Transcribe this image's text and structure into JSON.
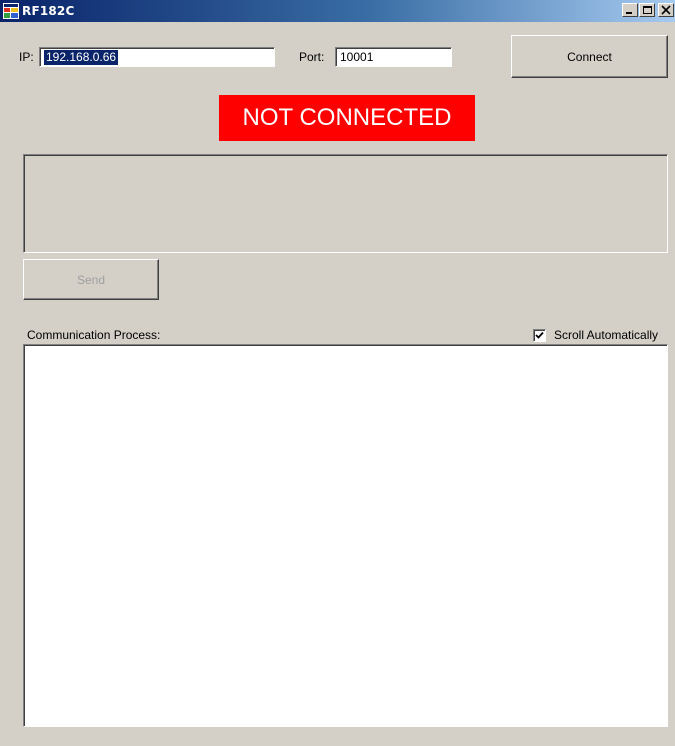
{
  "window": {
    "title": "RF182C",
    "icon": "app-window-icon",
    "controls": {
      "minimize": "minimize-icon",
      "maximize": "maximize-icon",
      "close": "close-icon"
    }
  },
  "connection": {
    "ip_label": "IP:",
    "ip_value": "192.168.0.66",
    "port_label": "Port:",
    "port_value": "10001",
    "connect_button": "Connect"
  },
  "status": {
    "text": "NOT CONNECTED",
    "color": "#ff0000"
  },
  "send": {
    "message_value": "",
    "button_label": "Send",
    "enabled": false
  },
  "log": {
    "label": "Communication Process:",
    "scroll_label": "Scroll Automatically",
    "scroll_checked": true,
    "content": ""
  },
  "colors": {
    "title_bar_start": "#0a246a",
    "title_bar_end": "#a6caf0",
    "window_face": "#d4d0c8",
    "status_background": "#ff0000"
  }
}
